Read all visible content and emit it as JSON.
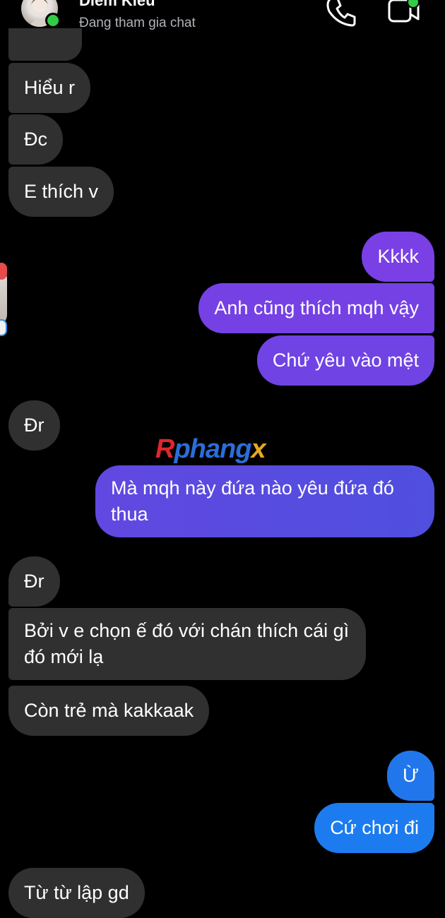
{
  "header": {
    "contact_name": "Diem Kieu",
    "status": "Đang tham gia chat"
  },
  "icons": {
    "call": "phone-icon",
    "video": "video-camera-icon"
  },
  "watermark": {
    "first": "R",
    "middle": "phang",
    "last": "x"
  },
  "messages": [
    {
      "from": "them",
      "text": "Hiểu r"
    },
    {
      "from": "them",
      "text": "Đc"
    },
    {
      "from": "them",
      "text": "E thích v"
    },
    {
      "from": "me",
      "text": "Kkkk"
    },
    {
      "from": "me",
      "text": "Anh cũng thích mqh vậy"
    },
    {
      "from": "me",
      "text": "Chứ yêu vào mệt"
    },
    {
      "from": "them",
      "text": "Đr"
    },
    {
      "from": "me",
      "text": "Mà mqh này đứa nào yêu đứa đó thua"
    },
    {
      "from": "them",
      "text": "Đr"
    },
    {
      "from": "them",
      "text": "Bởi v e chọn ế đó với chán thích cái gì đó mới lạ"
    },
    {
      "from": "them",
      "text": "Còn trẻ mà kakkaak"
    },
    {
      "from": "me",
      "text": "Ừ"
    },
    {
      "from": "me",
      "text": "Cứ chơi đi"
    },
    {
      "from": "them",
      "text": "Từ từ lập gd"
    }
  ],
  "colors": {
    "incoming_bubble": "#303030",
    "outgoing_gradient": [
      "#7b3fe4",
      "#6f44e3",
      "#5b4ae0",
      "#2f6fe6",
      "#1d7ff0"
    ],
    "online": "#31cc46"
  }
}
